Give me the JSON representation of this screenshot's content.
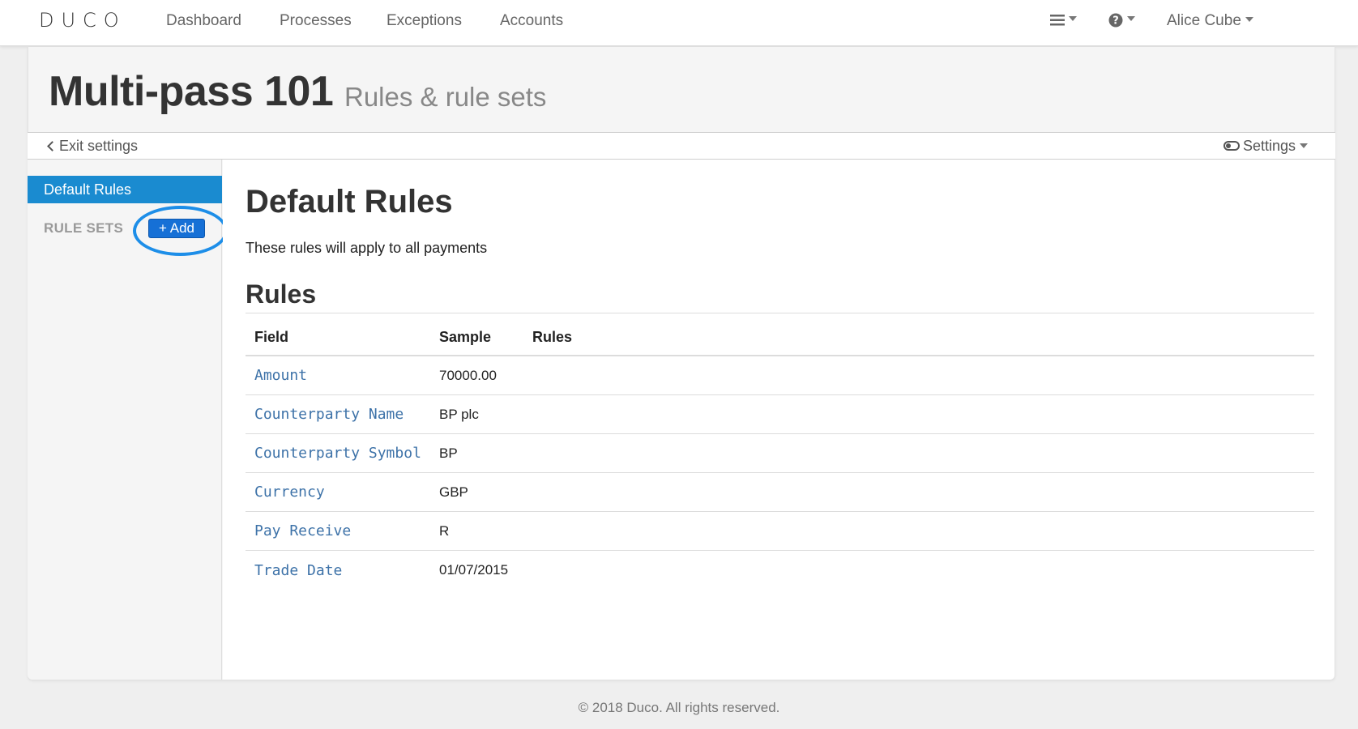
{
  "navbar": {
    "logo": "DUCO",
    "links": [
      "Dashboard",
      "Processes",
      "Exceptions",
      "Accounts"
    ],
    "menu_icon": "hamburger-icon",
    "help_icon": "question-circle-icon",
    "user": "Alice Cube"
  },
  "header": {
    "title": "Multi-pass 101",
    "subtitle": "Rules & rule sets"
  },
  "settings_bar": {
    "exit_label": "Exit settings",
    "settings_label": "Settings"
  },
  "sidebar": {
    "active_item": "Default Rules",
    "rulesets_label": "RULE SETS",
    "add_label": "+ Add"
  },
  "content": {
    "title": "Default Rules",
    "description": "These rules will apply to all payments",
    "rules_heading": "Rules",
    "columns": [
      "Field",
      "Sample",
      "Rules"
    ],
    "rows": [
      {
        "field": "Amount",
        "sample": "70000.00"
      },
      {
        "field": "Counterparty Name",
        "sample": "BP plc"
      },
      {
        "field": "Counterparty Symbol",
        "sample": "BP"
      },
      {
        "field": "Currency",
        "sample": "GBP"
      },
      {
        "field": "Pay Receive",
        "sample": "R"
      },
      {
        "field": "Trade Date",
        "sample": "01/07/2015"
      }
    ]
  },
  "footer": {
    "text": "© 2018 Duco. All rights reserved."
  },
  "colors": {
    "accent": "#1a8bd0",
    "add_button": "#1670d6",
    "highlight": "#1d8ee8",
    "link": "#3d72a8"
  }
}
